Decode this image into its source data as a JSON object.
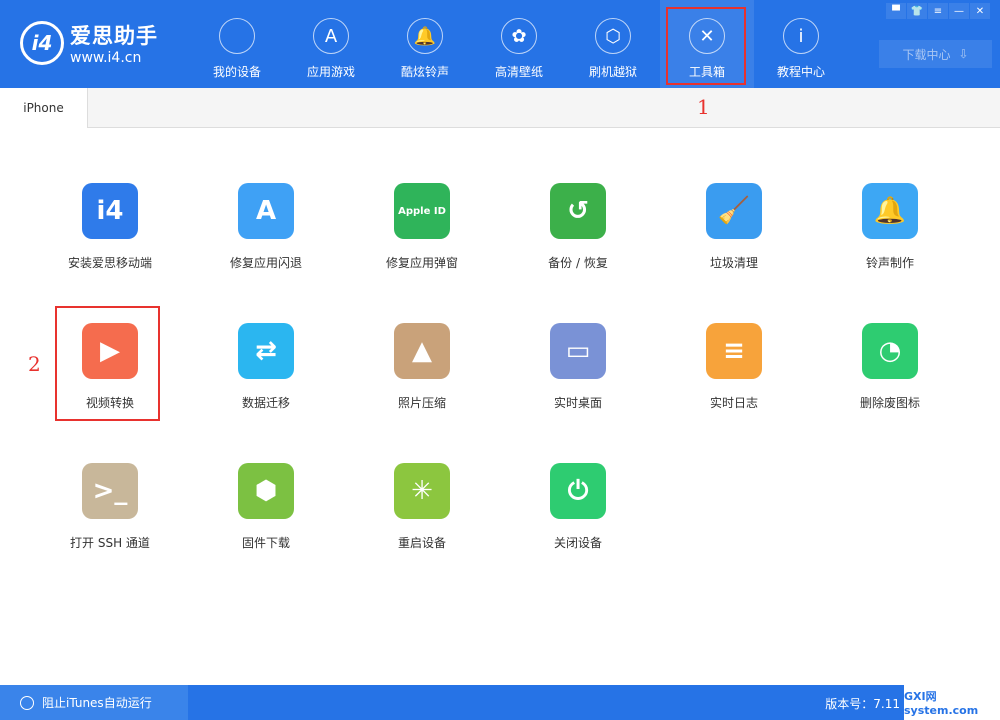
{
  "app": {
    "name": "爱思助手",
    "url": "www.i4.cn",
    "logo": "i4"
  },
  "nav": [
    {
      "label": "我的设备",
      "icon": "apple-icon",
      "glyph": ""
    },
    {
      "label": "应用游戏",
      "icon": "app-store-icon",
      "glyph": "A"
    },
    {
      "label": "酷炫铃声",
      "icon": "bell-icon",
      "glyph": "🔔"
    },
    {
      "label": "高清壁纸",
      "icon": "flower-icon",
      "glyph": "✿"
    },
    {
      "label": "刷机越狱",
      "icon": "box-icon",
      "glyph": "⬡"
    },
    {
      "label": "工具箱",
      "icon": "tools-icon",
      "glyph": "✕"
    },
    {
      "label": "教程中心",
      "icon": "info-icon",
      "glyph": "i"
    }
  ],
  "window_buttons": {
    "feedback": "▀",
    "skin": "👕",
    "menu": "≡",
    "minimize": "—",
    "close": "✕"
  },
  "download": {
    "label": "下载中心",
    "icon": "⇩"
  },
  "tab": {
    "label": "iPhone"
  },
  "annotations": [
    "1",
    "2"
  ],
  "tools": [
    {
      "label": "安装爱思移动端",
      "glyph": "i4",
      "color": "#2f7bea"
    },
    {
      "label": "修复应用闪退",
      "glyph": "A",
      "color": "#3fa1f5"
    },
    {
      "label": "修复应用弹窗",
      "glyph": "Apple ID",
      "color": "#2fb45a"
    },
    {
      "label": "备份 / 恢复",
      "glyph": "↺",
      "color": "#3cb04a"
    },
    {
      "label": "垃圾清理",
      "glyph": "🧹",
      "color": "#3a9cf0"
    },
    {
      "label": "铃声制作",
      "glyph": "🔔",
      "color": "#3da7f4"
    },
    {
      "label": "视频转换",
      "glyph": "▶",
      "color": "#f56c4e"
    },
    {
      "label": "数据迁移",
      "glyph": "⇄",
      "color": "#2bb6f0"
    },
    {
      "label": "照片压缩",
      "glyph": "▲",
      "color": "#c9a27a"
    },
    {
      "label": "实时桌面",
      "glyph": "▭",
      "color": "#7a92d6"
    },
    {
      "label": "实时日志",
      "glyph": "≡",
      "color": "#f7a33b"
    },
    {
      "label": "删除废图标",
      "glyph": "◔",
      "color": "#2ecc71"
    },
    {
      "label": "打开 SSH 通道",
      "glyph": ">_",
      "color": "#c8b79a"
    },
    {
      "label": "固件下载",
      "glyph": "⬢",
      "color": "#7cc142"
    },
    {
      "label": "重启设备",
      "glyph": "✳",
      "color": "#8cc63f"
    },
    {
      "label": "关闭设备",
      "glyph": "⏻",
      "color": "#2ecc71"
    }
  ],
  "status": {
    "itunes": "阻止iTunes自动运行",
    "version": "版本号：7.11",
    "watermark": "GXI网 system.com"
  }
}
